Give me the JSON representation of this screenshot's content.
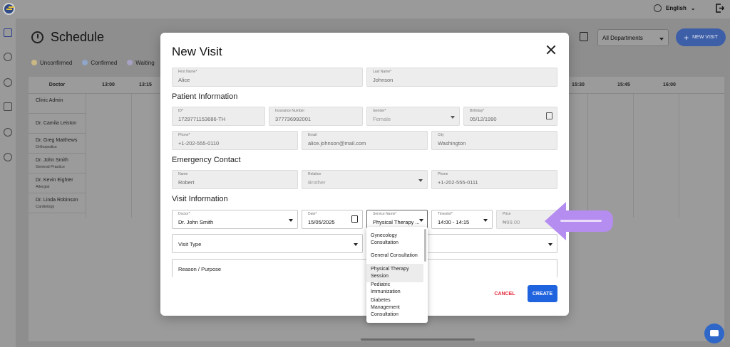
{
  "app": {
    "language": "English",
    "page_title": "Schedule",
    "legend": [
      {
        "label": "Unconfirmed",
        "color": "#c9b784"
      },
      {
        "label": "Confirmed",
        "color": "#8fa5c9"
      },
      {
        "label": "Waiting",
        "color": "#a6a0c2"
      }
    ],
    "department": "All Departments",
    "new_visit_button": "NEW VISIT",
    "grid_header_doctor": "Doctor",
    "time_slots": [
      "13:00",
      "13:15",
      "15:30",
      "15:45",
      "16:00"
    ],
    "doctors": [
      {
        "name": "Clinic Admin",
        "specialty": ""
      },
      {
        "name": "Dr. Camila Leiston",
        "specialty": ""
      },
      {
        "name": "Dr. Greg Matthews",
        "specialty": "Orthopedics"
      },
      {
        "name": "Dr. John Smith",
        "specialty": "General Practice"
      },
      {
        "name": "Dr. Kevin Eighter",
        "specialty": "Allergist"
      },
      {
        "name": "Dr. Linda Robinson",
        "specialty": "Cardiology"
      }
    ]
  },
  "modal": {
    "title": "New Visit",
    "first_name": {
      "label": "First Name*",
      "value": "Alice"
    },
    "last_name": {
      "label": "Last Name*",
      "value": "Johnson"
    },
    "patient_section": "Patient Information",
    "id": {
      "label": "ID*",
      "value": "1729771153686-TH"
    },
    "insurance": {
      "label": "Insurance Number",
      "value": "377736992001"
    },
    "gender": {
      "label": "Gender*",
      "value": "Female"
    },
    "birthday": {
      "label": "Birthday*",
      "value": "05/12/1990"
    },
    "phone": {
      "label": "Phone*",
      "value": "+1-202-555-0110"
    },
    "email": {
      "label": "Email",
      "value": "alice.johnson@mail.com"
    },
    "city": {
      "label": "City",
      "value": "Washington"
    },
    "emergency_section": "Emergency Contact",
    "ec_name": {
      "label": "Name",
      "value": "Robert"
    },
    "ec_relation": {
      "label": "Relation",
      "value": "Brother"
    },
    "ec_phone": {
      "label": "Phone",
      "value": "+1-202-555-0111"
    },
    "visit_section": "Visit Information",
    "doctor": {
      "label": "Doctor*",
      "value": "Dr. John Smith"
    },
    "date": {
      "label": "Date*",
      "value": "15/05/2025"
    },
    "service": {
      "label": "Service Name*",
      "value": "Physical Therapy ..."
    },
    "timeslot": {
      "label": "Timeslot*",
      "value": "14:00 - 14:15"
    },
    "price": {
      "label": "Price",
      "value": "₦99.00"
    },
    "visit_type": {
      "placeholder": "Visit Type"
    },
    "reason": {
      "placeholder": "Reason / Purpose"
    },
    "cancel": "CANCEL",
    "create": "CREATE"
  },
  "service_options": [
    {
      "lines": [
        "Gynecology",
        "Consultation"
      ],
      "selected": false
    },
    {
      "lines": [
        "General Consultation"
      ],
      "selected": false
    },
    {
      "lines": [
        "Physical Therapy",
        "Session"
      ],
      "selected": true
    },
    {
      "lines": [
        "Pediatric",
        "Immunization"
      ],
      "selected": false
    },
    {
      "lines": [
        "Diabetes",
        "Management",
        "Consultation"
      ],
      "selected": false
    }
  ],
  "colors": {
    "accent": "#1f63de",
    "danger": "#e2283a",
    "arrow": "#b58cf0",
    "overlay": "#8e8e8e"
  }
}
